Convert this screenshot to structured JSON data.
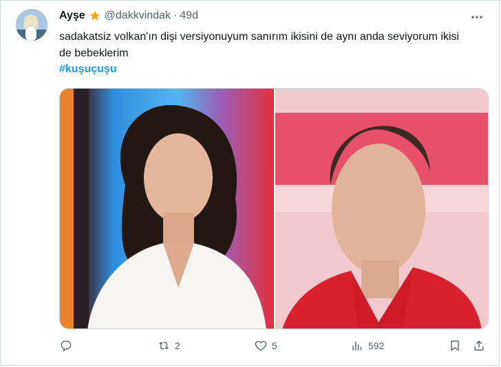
{
  "tweet": {
    "author_name": "Ayşe",
    "handle": "@dakkvindak",
    "separator": "·",
    "time": "49d",
    "text": "sadakatsiz volkan'ın dişi versiyonuyum sanırım  ikisini de aynı anda seviyorum ikisi de bebeklerim",
    "hashtag": "#kuşuçuşu"
  },
  "actions": {
    "reply_count": "",
    "retweet_count": "2",
    "like_count": "5",
    "view_count": "592"
  },
  "colors": {
    "accent": "#1d9bf0",
    "secondary_text": "#536471",
    "star": "#f4a51c"
  },
  "icons": [
    "verified-star-icon",
    "more-icon",
    "reply-icon",
    "retweet-icon",
    "like-icon",
    "views-icon",
    "bookmark-icon",
    "share-icon"
  ]
}
